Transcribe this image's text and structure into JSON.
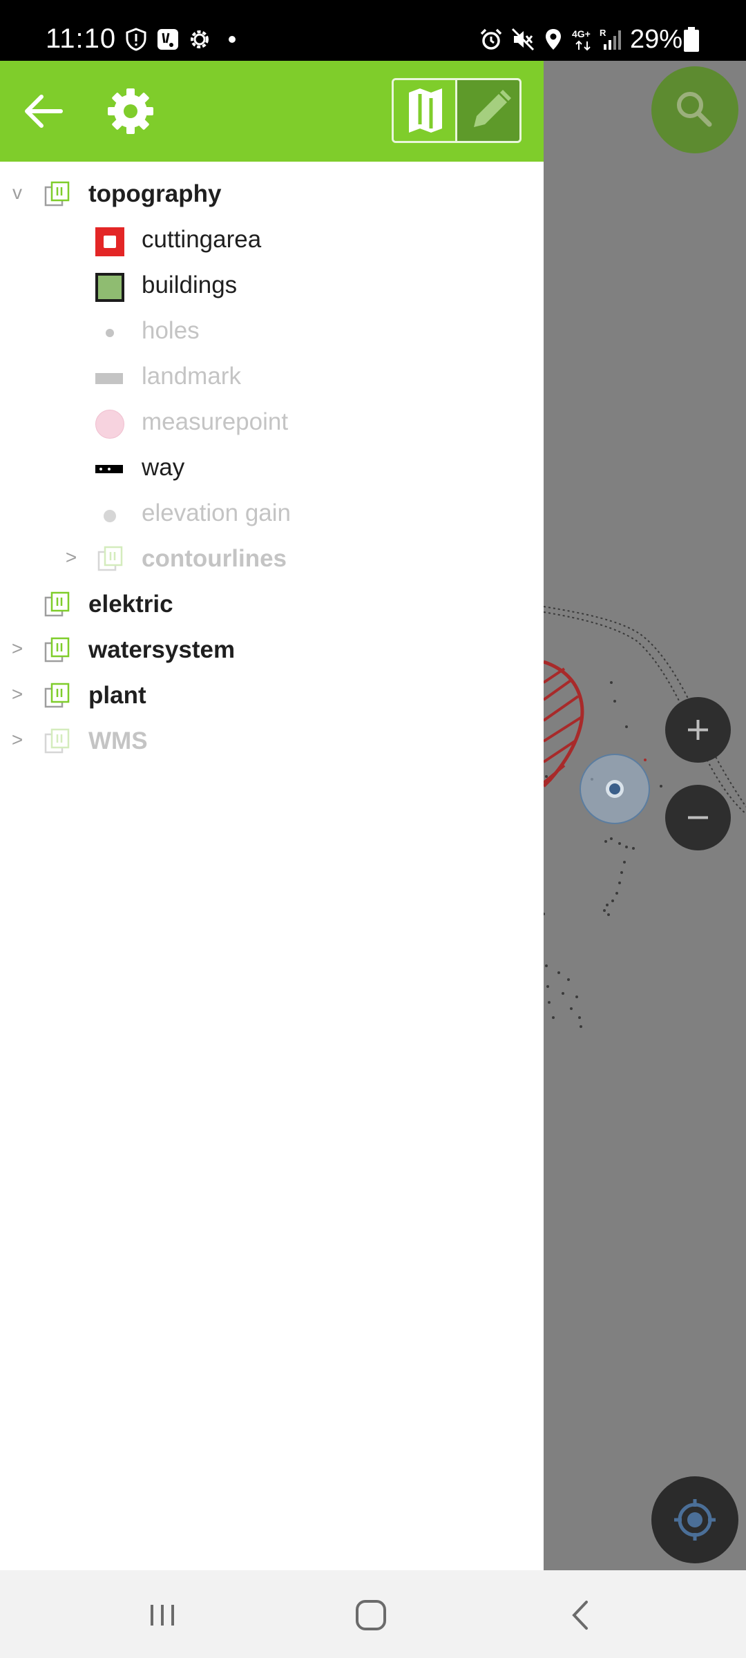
{
  "status_bar": {
    "time": "11:10",
    "battery": "29%",
    "left_icons": [
      "shield-icon",
      "app-notification-icon",
      "gear-icon",
      "dot-icon"
    ],
    "right_icons": [
      "alarm-icon",
      "mute-icon",
      "location-icon",
      "4g-plus-icon",
      "signal-icon",
      "battery-icon"
    ]
  },
  "toolbar": {
    "accent": "#7fcd2b",
    "back_icon": "arrow-left-icon",
    "settings_icon": "gear-icon",
    "mode_map_icon": "map-icon",
    "mode_edit_icon": "pencil-icon",
    "active_mode": "map"
  },
  "layers": {
    "topography": {
      "label": "topography",
      "expander": "v",
      "icon": "layers-icon"
    },
    "cuttingarea": {
      "label": "cuttingarea",
      "swatch_color": "#e32626"
    },
    "buildings": {
      "label": "buildings",
      "swatch_color": "#8fbc71"
    },
    "holes": {
      "label": "holes"
    },
    "landmark": {
      "label": "landmark"
    },
    "measurepoint": {
      "label": "measurepoint",
      "swatch_color": "#f7d3df"
    },
    "way": {
      "label": "way"
    },
    "elevation_gain": {
      "label": "elevation gain"
    },
    "contourlines": {
      "label": "contourlines",
      "expander": ">"
    },
    "elektric": {
      "label": "elektric"
    },
    "watersystem": {
      "label": "watersystem",
      "expander": ">"
    },
    "plant": {
      "label": "plant",
      "expander": ">"
    },
    "wms": {
      "label": "WMS",
      "expander": ">"
    }
  },
  "map": {
    "search_icon": "search-icon",
    "zoom_in_icon": "plus-icon",
    "zoom_out_icon": "minus-icon",
    "locate_icon": "crosshair-icon"
  },
  "nav_bar": {
    "recents_icon": "recents-icon",
    "home_icon": "home-icon",
    "back_icon": "back-chevron-icon"
  }
}
